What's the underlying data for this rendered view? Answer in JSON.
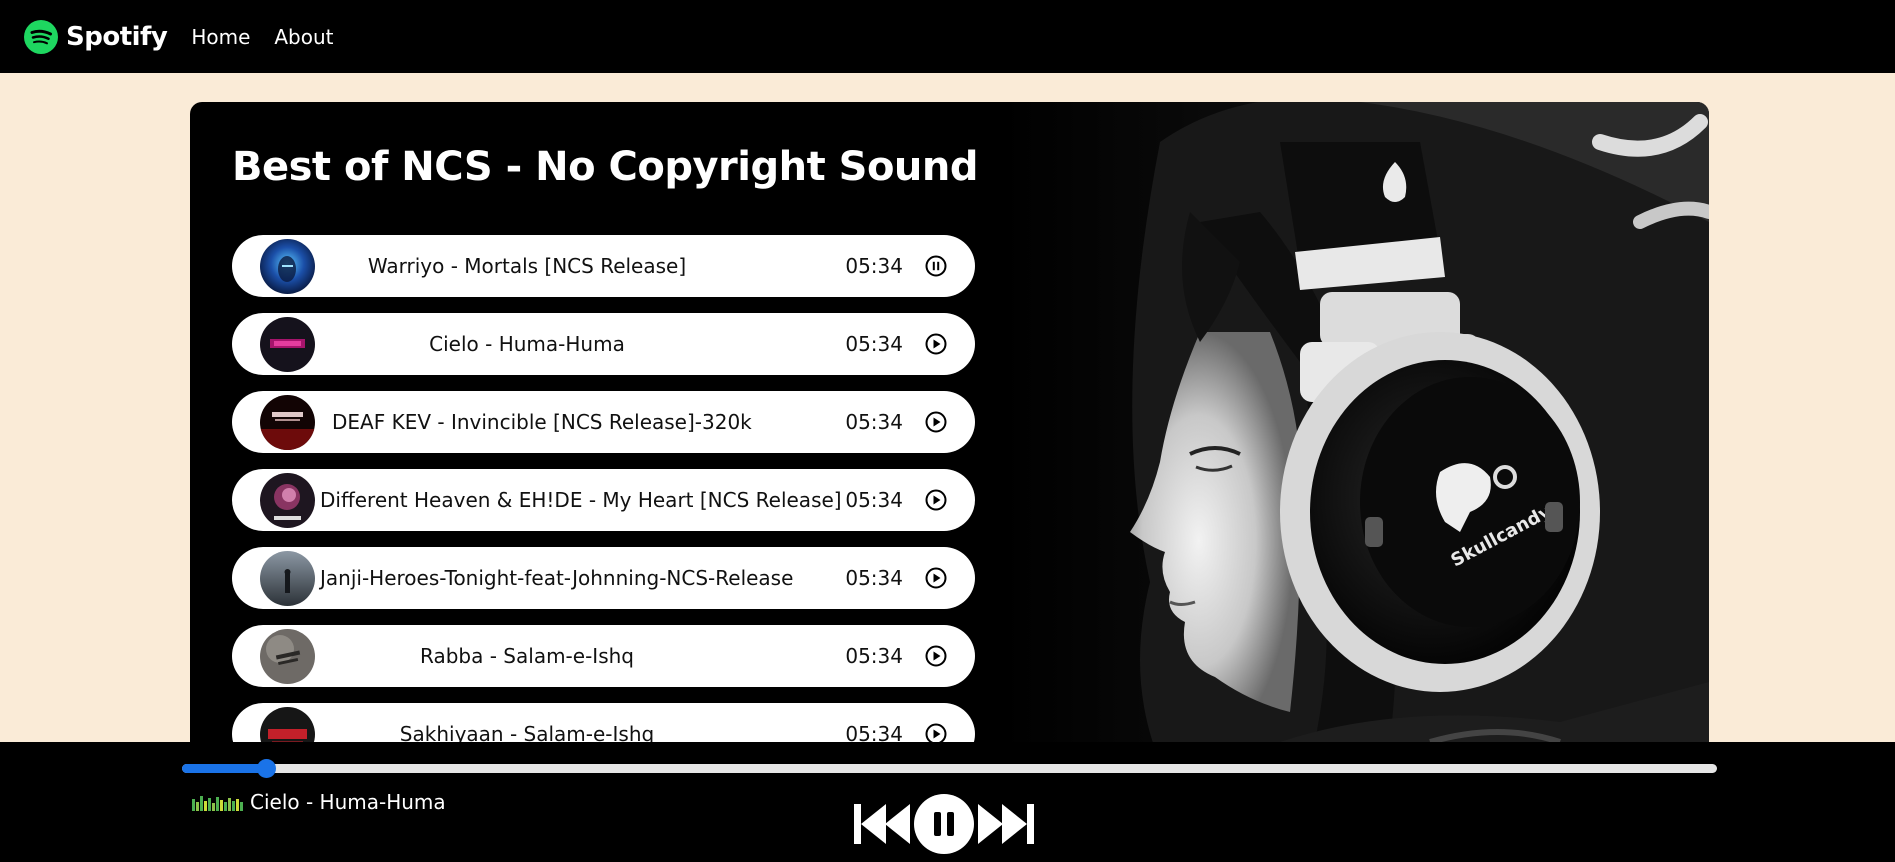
{
  "nav": {
    "brand": "Spotify",
    "links": [
      "Home",
      "About"
    ]
  },
  "colors": {
    "brand_green": "#1ed760",
    "page_background": "#faebd7",
    "accent_blue": "#1a73e8"
  },
  "playlist": {
    "title": "Best of NCS - No Copyright Sound",
    "songs": [
      {
        "name": "Warriyo - Mortals [NCS Release]",
        "duration": "05:34",
        "state_icon": "pause-circle-icon"
      },
      {
        "name": "Cielo - Huma-Huma",
        "duration": "05:34",
        "state_icon": "play-circle-icon"
      },
      {
        "name": "DEAF KEV - Invincible [NCS Release]-320k",
        "duration": "05:34",
        "state_icon": "play-circle-icon"
      },
      {
        "name": "Different Heaven & EH!DE - My Heart [NCS Release]",
        "duration": "05:34",
        "state_icon": "play-circle-icon"
      },
      {
        "name": "Janji-Heroes-Tonight-feat-Johnning-NCS-Release",
        "duration": "05:34",
        "state_icon": "play-circle-icon"
      },
      {
        "name": "Rabba - Salam-e-Ishq",
        "duration": "05:34",
        "state_icon": "play-circle-icon"
      },
      {
        "name": "Sakhiyaan - Salam-e-Ishq",
        "duration": "05:34",
        "state_icon": "play-circle-icon"
      }
    ]
  },
  "player": {
    "progress_fraction": 0.055,
    "now_playing": "Cielo - Huma-Huma",
    "controls": [
      "previous-icon",
      "pause-icon",
      "next-icon"
    ]
  }
}
